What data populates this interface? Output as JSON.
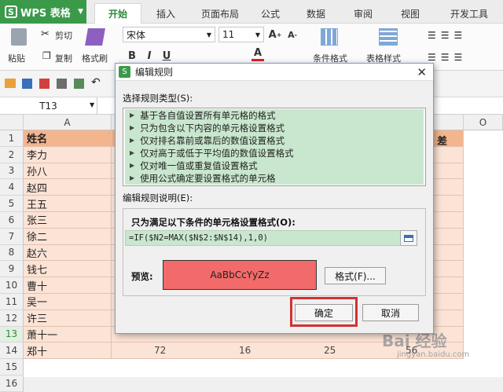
{
  "app": {
    "name": "WPS 表格"
  },
  "tabs": [
    "开始",
    "插入",
    "页面布局",
    "公式",
    "数据",
    "审阅",
    "视图",
    "开发工具"
  ],
  "ribbon": {
    "cut": "剪切",
    "paste": "粘贴",
    "copy": "复制",
    "format_painter": "格式刷",
    "font": "宋体",
    "size": "11",
    "cond_format": "条件格式",
    "table_style": "表格样式"
  },
  "namebox": "T13",
  "columns": {
    "a": "A",
    "o": "O"
  },
  "rows": [
    "1",
    "2",
    "3",
    "4",
    "5",
    "6",
    "7",
    "8",
    "9",
    "10",
    "11",
    "12",
    "13",
    "14",
    "15",
    "16"
  ],
  "names": [
    "姓名",
    "李力",
    "孙八",
    "赵四",
    "王五",
    "张三",
    "徐二",
    "赵六",
    "钱七",
    "曹十",
    "吴一",
    "许三",
    "萧十一",
    "郑十"
  ],
  "header_partial": "差",
  "row14_values": [
    "72",
    "16",
    "25",
    "56"
  ],
  "dialog": {
    "title": "编辑规则",
    "type_label": "选择规则类型(S):",
    "rule_types": [
      "基于各自值设置所有单元格的格式",
      "只为包含以下内容的单元格设置格式",
      "仅对排名靠前或靠后的数值设置格式",
      "仅对高于或低于平均值的数值设置格式",
      "仅对唯一值或重复值设置格式",
      "使用公式确定要设置格式的单元格"
    ],
    "desc_label": "编辑规则说明(E):",
    "condition_label": "只为满足以下条件的单元格设置格式(O):",
    "formula": "=IF($N2=MAX($N$2:$N$14),1,0)",
    "preview_label": "预览:",
    "preview_text": "AaBbCcYyZz",
    "format_button": "格式(F)...",
    "ok": "确定",
    "cancel": "取消"
  },
  "watermark": {
    "logo": "Bai 经验",
    "url": "jingyan.baidu.com"
  },
  "colors": {
    "accent": "#3a9a4a",
    "header_fill": "#f3b58e",
    "row_fill": "#fbe3d6",
    "selection": "#c9e7cf",
    "preview": "#f26a6a",
    "highlight": "#d23232"
  }
}
